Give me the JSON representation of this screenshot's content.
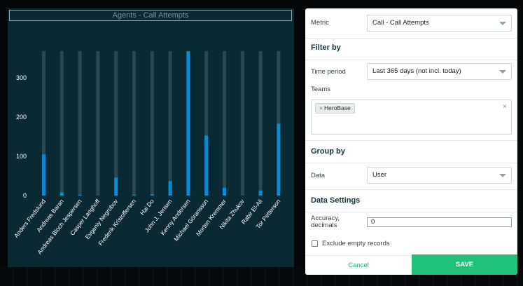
{
  "chart_data": {
    "type": "bar",
    "title": "Agents - Call Attempts",
    "categories": [
      "Anders Fredslund",
      "Andreas Baran",
      "Andreas Bloch Jespersen",
      "Casper Langhoff",
      "Evgeniy Negrobov",
      "Frederik Kristoffersen",
      "Hai Do",
      "John J. Jensen",
      "Kenny Andersen",
      "Michael Göransson",
      "Morten Kremmer",
      "Nikita Zhukov",
      "Rabir El-Ali",
      "Tor Petterson"
    ],
    "values": [
      105,
      8,
      2,
      0,
      46,
      2,
      3,
      37,
      368,
      153,
      20,
      0,
      13,
      183
    ],
    "max_value": 368,
    "yticks": [
      "0",
      "100",
      "200",
      "300"
    ],
    "ylim": [
      0,
      380
    ],
    "colors": {
      "bar": "#0a8ad2",
      "track": "#2a4850",
      "background": "#0a2a33",
      "tick_text": "#ffffff"
    }
  },
  "filter": {
    "metric": {
      "label": "Metric",
      "value": "Call - Call Attempts"
    },
    "filter_by": {
      "heading": "Filter by",
      "time_period": {
        "label": "Time period",
        "value": "Last 365 days (not incl. today)"
      },
      "teams": {
        "label": "Teams",
        "tags": [
          "HeroBase"
        ],
        "tag_remove": "×",
        "clear": "×"
      }
    },
    "group_by": {
      "heading": "Group by",
      "data": {
        "label": "Data",
        "value": "User"
      }
    },
    "data_settings": {
      "heading": "Data Settings",
      "accuracy": {
        "label_line1": "Accuracy,",
        "label_line2": "decimals",
        "value": "0"
      },
      "exclude_empty": {
        "label": "Exclude empty records",
        "checked": false
      }
    },
    "buttons": {
      "cancel": "Cancel",
      "save": "SAVE"
    },
    "colors": {
      "save": "#1fc17b",
      "cancel_text": "#27ae73",
      "heading": "#13333b"
    }
  }
}
